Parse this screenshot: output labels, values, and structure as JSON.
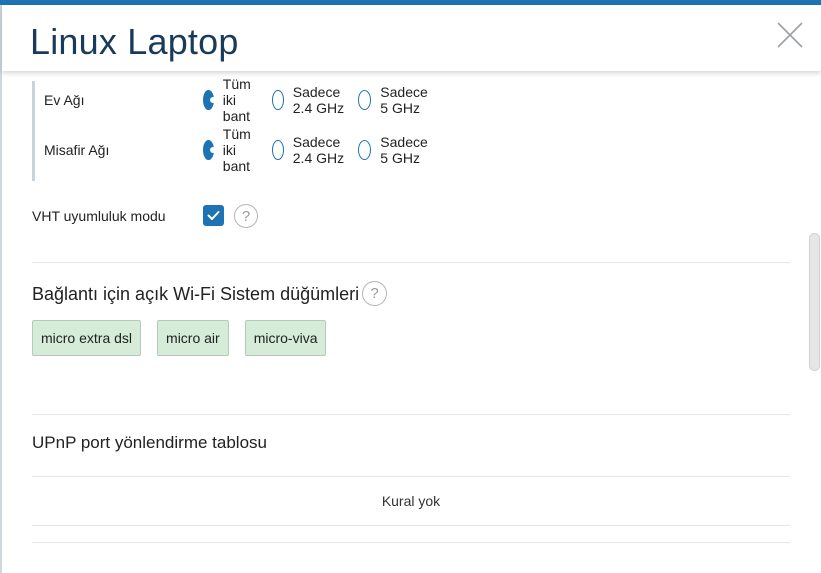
{
  "dialog": {
    "title": "Linux Laptop"
  },
  "band_rows": [
    {
      "label": "Ev Ağı",
      "options": [
        "Tüm iki bant",
        "Sadece 2.4 GHz",
        "Sadece 5 GHz"
      ],
      "selected": 0
    },
    {
      "label": "Misafir Ağı",
      "options": [
        "Tüm iki bant",
        "Sadece 2.4 GHz",
        "Sadece 5 GHz"
      ],
      "selected": 0
    }
  ],
  "vht": {
    "label": "VHT uyumluluk modu",
    "checked": true,
    "help": "?"
  },
  "mesh": {
    "title": "Bağlantı için açık Wi-Fi Sistem düğümleri",
    "help": "?",
    "nodes": [
      "micro extra dsl",
      "micro air",
      "micro-viva"
    ]
  },
  "upnp": {
    "title": "UPnP port yönlendirme tablosu",
    "empty_text": "Kural yok"
  },
  "colors": {
    "accent": "#1e73b3",
    "tag_bg": "#d4ecd8",
    "title": "#1a3a5c"
  },
  "icons": {
    "close": "close-icon",
    "check": "checkmark-icon",
    "help": "question-icon"
  }
}
